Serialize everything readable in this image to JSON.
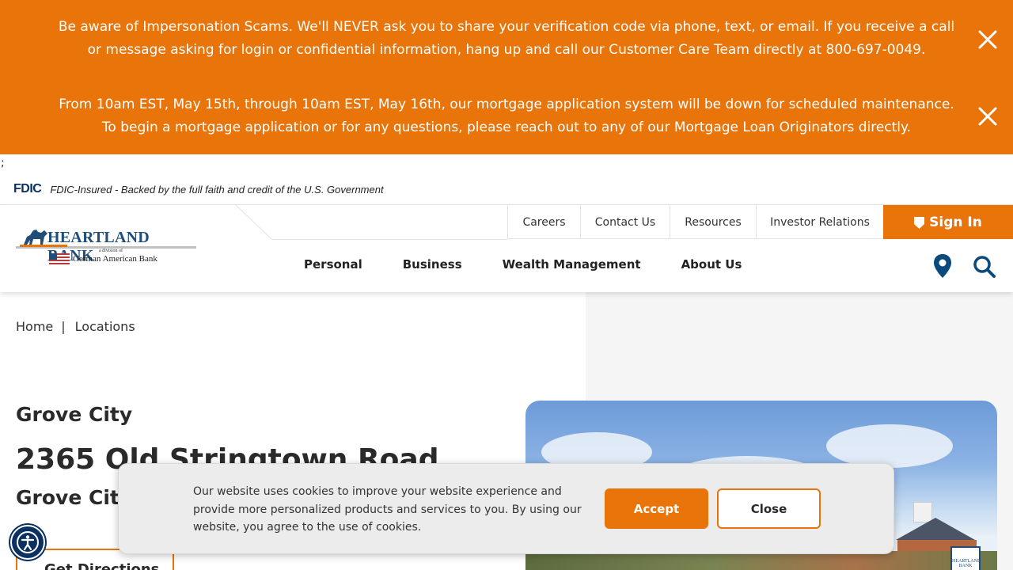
{
  "alerts": [
    {
      "text": "Be aware of Impersonation Scams. We'll NEVER ask you to share your verification code via phone, text, or email. If you receive a call or message asking for login or confidential information, hang up and call our Customer Care Team directly at 800-697-0049."
    },
    {
      "text": "From 10am EST, May 15th, through 10am EST, May 16th, our mortgage application system will be down for scheduled maintenance. To begin a mortgage application or for any questions, please reach out to any of our Mortgage Loan Originators directly."
    }
  ],
  "stray_text": ";",
  "fdic": {
    "logo": "FDIC",
    "text": "FDIC-Insured - Backed by the full faith and credit of the U.S. Government"
  },
  "logo": {
    "name": "HEARTLAND BANK",
    "division": "a division of",
    "parent": "German American Bank"
  },
  "util_nav": {
    "careers": "Careers",
    "contact": "Contact Us",
    "resources": "Resources",
    "investor": "Investor Relations"
  },
  "signin": {
    "label": "Sign In",
    "icon": "shield-icon"
  },
  "main_nav": {
    "personal": "Personal",
    "business": "Business",
    "wealth": "Wealth Management",
    "about": "About Us"
  },
  "breadcrumb": {
    "home": "Home",
    "separator": "|",
    "current": "Locations"
  },
  "location": {
    "name": "Grove City",
    "address": "2365 Old Stringtown Road",
    "city": "Grove City",
    "directions_label": "Get Directions"
  },
  "photo": {
    "sign_text": "HEARTLAND BANK"
  },
  "cookie": {
    "text": "Our website uses cookies to improve your website experience and provide more personalized products and services to you. By using our website, you agree to the use of cookies.",
    "accept_label": "Accept",
    "close_label": "Close"
  },
  "colors": {
    "accent": "#e8740a",
    "navy": "#0a3161",
    "grey_panel": "#f5f5f5"
  }
}
